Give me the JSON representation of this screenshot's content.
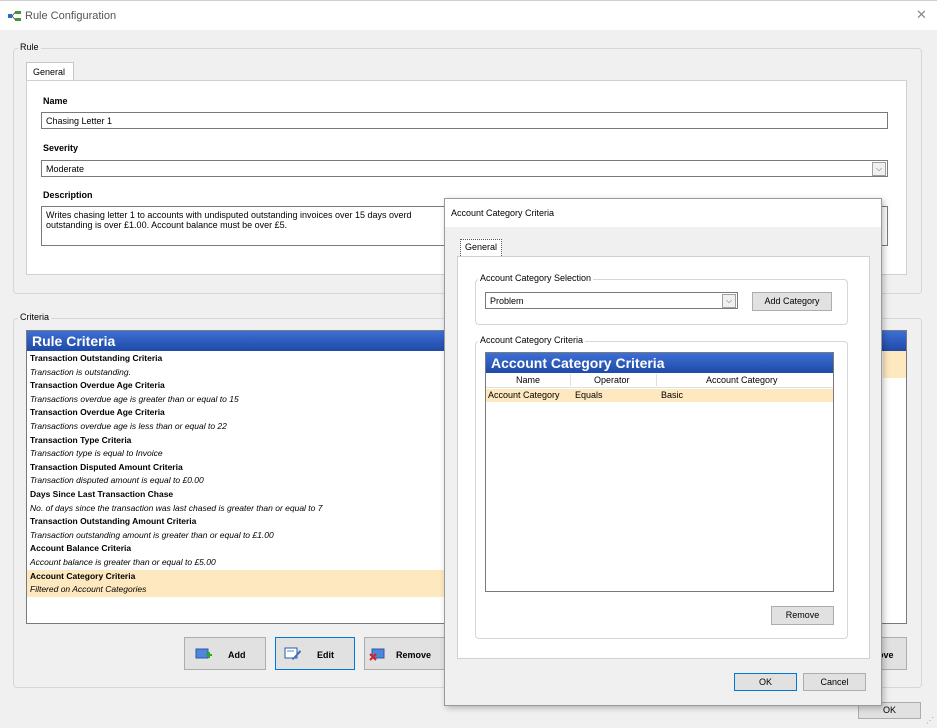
{
  "window": {
    "title": "Rule Configuration",
    "close_glyph": "✕"
  },
  "rule_group": {
    "label": "Rule",
    "tab": "General",
    "name_label": "Name",
    "name_value": "Chasing Letter 1",
    "severity_label": "Severity",
    "severity_value": "Moderate",
    "description_label": "Description",
    "description_line1": "Writes chasing letter 1 to accounts with undisputed outstanding invoices over 15 days overd",
    "description_line2": "outstanding is over £1.00. Account balance must be over £5."
  },
  "criteria_group": {
    "label": "Criteria",
    "list_title": "Rule Criteria",
    "items": [
      {
        "text": "Transaction Outstanding Criteria",
        "style": "bold"
      },
      {
        "text": "Transaction is outstanding.",
        "style": "italic"
      },
      {
        "text": "Transaction Overdue Age Criteria",
        "style": "bold"
      },
      {
        "text": "Transactions overdue age is greater than or equal to 15",
        "style": "italic"
      },
      {
        "text": "Transaction Overdue Age Criteria",
        "style": "bold"
      },
      {
        "text": "Transactions overdue age is less than or equal to 22",
        "style": "italic"
      },
      {
        "text": "Transaction Type Criteria",
        "style": "bold"
      },
      {
        "text": "Transaction type is equal to Invoice",
        "style": "italic"
      },
      {
        "text": "Transaction Disputed Amount Criteria",
        "style": "bold"
      },
      {
        "text": "Transaction disputed amount is equal to £0.00",
        "style": "italic"
      },
      {
        "text": "Days Since Last Transaction Chase",
        "style": "bold"
      },
      {
        "text": "No. of days since the transaction was last chased is greater than or equal to 7",
        "style": "italic"
      },
      {
        "text": "Transaction Outstanding Amount Criteria",
        "style": "bold"
      },
      {
        "text": "Transaction outstanding amount is greater than or equal to £1.00",
        "style": "italic"
      },
      {
        "text": "Account Balance Criteria",
        "style": "bold"
      },
      {
        "text": "Account balance is greater than or equal to £5.00",
        "style": "italic"
      },
      {
        "text": "Account Category Criteria",
        "style": "bold-selected"
      },
      {
        "text": "Filtered on Account Categories",
        "style": "italic-selected"
      }
    ],
    "add_label": "Add",
    "edit_label": "Edit",
    "remove_label": "Remove",
    "move_label": "ove"
  },
  "main_ok_label": "OK",
  "dialog": {
    "title": "Account Category Criteria",
    "tab": "General",
    "selection_group_label": "Account Category Selection",
    "selection_value": "Problem",
    "add_category_label": "Add Category",
    "criteria_group_label": "Account Category Criteria",
    "list_title": "Account Category Criteria",
    "columns": [
      "Name",
      "Operator",
      "Account Category"
    ],
    "rows": [
      {
        "name": "Account Category",
        "operator": "Equals",
        "category": "Basic"
      }
    ],
    "remove_label": "Remove",
    "ok_label": "OK",
    "cancel_label": "Cancel"
  },
  "colors": {
    "header_blue": "#2a57b8",
    "selected_row": "#fde8bf",
    "accent": "#0078d7"
  }
}
